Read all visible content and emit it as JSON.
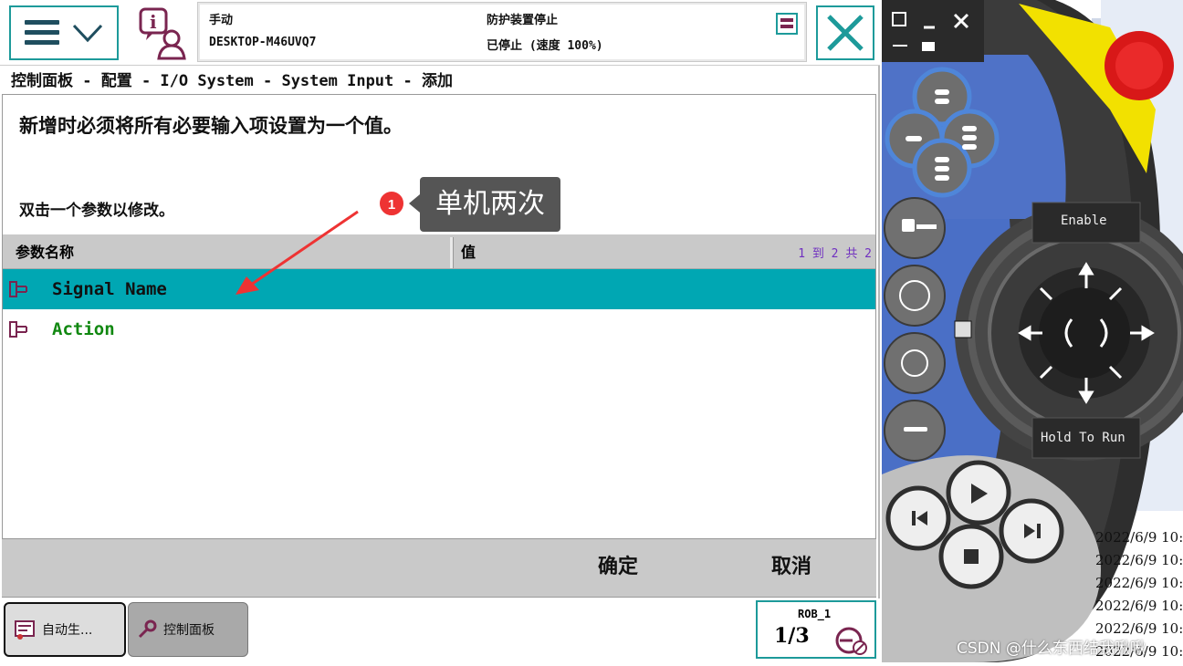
{
  "header": {
    "mode": "手动",
    "device": "DESKTOP-M46UVQ7",
    "safety_status": "防护装置停止",
    "run_status": "已停止 (速度 100%)"
  },
  "breadcrumb": "控制面板 - 配置 - I/O System - System Input - 添加",
  "instruction": "新增时必须将所有必要输入项设置为一个值。",
  "hint": "双击一个参数以修改。",
  "table": {
    "columns": [
      "参数名称",
      "值"
    ],
    "pagination": "1 到 2 共 2",
    "rows": [
      {
        "name": "Signal Name",
        "value": "",
        "selected": true
      },
      {
        "name": "Action",
        "value": "",
        "selected": false
      }
    ]
  },
  "callout": {
    "number": "1",
    "text": "单机两次"
  },
  "actions": {
    "ok": "确定",
    "cancel": "取消"
  },
  "taskbar": {
    "task1": "自动生...",
    "task2": "控制面板",
    "robot": "ROB_1",
    "fraction": "1/3"
  },
  "pendant": {
    "enable": "Enable",
    "hold_to_run": "Hold To Run"
  },
  "log": [
    "2022/6/9 10:",
    "2022/6/9 10:",
    "2022/6/9 10:",
    "2022/6/9 10:",
    "2022/6/9 10:",
    "2022/6/9 10:"
  ],
  "watermark": "CSDN @什么东西结我啾啾",
  "colors": {
    "accent": "#1d9a9a",
    "selected_row": "#00a7b3",
    "callout_bg": "#555555",
    "callout_dot": "#ee3333"
  }
}
